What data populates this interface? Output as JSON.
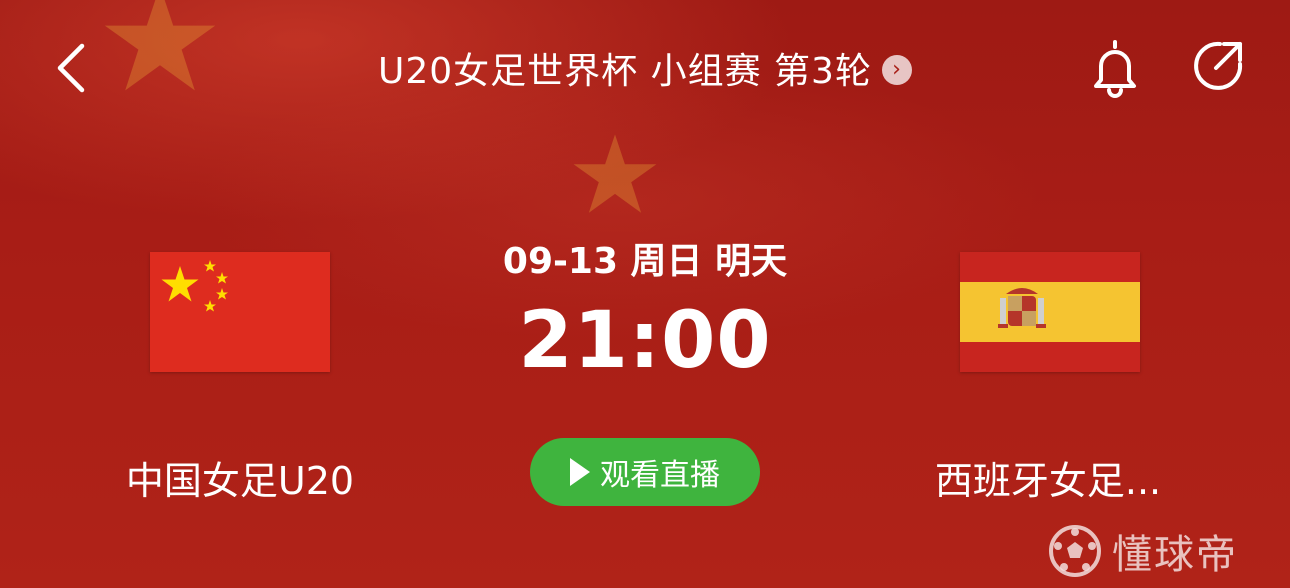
{
  "header": {
    "title": "U20女足世界杯 小组赛 第3轮",
    "back_icon": "chevron-left-icon",
    "title_arrow_icon": "chevron-right-icon",
    "bell_icon": "bell-icon",
    "share_icon": "share-icon"
  },
  "match": {
    "date_line": "09-13 周日 明天",
    "time": "21:00",
    "watch_label": "观看直播"
  },
  "home_team": {
    "name": "中国女足U20",
    "flag_icon": "china-flag-icon"
  },
  "away_team": {
    "name": "西班牙女足...",
    "flag_icon": "spain-flag-icon"
  },
  "watermark": {
    "text": "懂球帝",
    "icon": "soccer-ball-icon"
  },
  "colors": {
    "background": "#a81d16",
    "watch_button": "#3fb43e",
    "china_red": "#de2c1f",
    "spain_yellow": "#f5c431",
    "star_yellow": "#ffde00"
  }
}
